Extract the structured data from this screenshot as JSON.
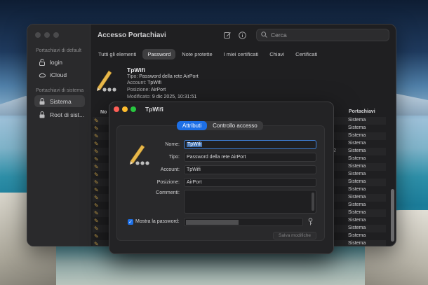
{
  "window": {
    "title": "Accesso Portachiavi",
    "search_placeholder": "Cerca"
  },
  "sidebar": {
    "section_default": "Portachiavi di default",
    "section_system": "Portachiavi di sistema",
    "items": [
      {
        "label": "login",
        "icon": "lock-open-icon"
      },
      {
        "label": "iCloud",
        "icon": "cloud-icon"
      },
      {
        "label": "Sistema",
        "icon": "lock-icon"
      },
      {
        "label": "Root di sist...",
        "icon": "lock-icon"
      }
    ]
  },
  "tabs": [
    "Tutti gli elementi",
    "Password",
    "Note protette",
    "I miei certificati",
    "Chiavi",
    "Certificati"
  ],
  "active_tab": "Password",
  "detail": {
    "name": "TpWifi",
    "tipo_label": "Tipo:",
    "tipo_value": "Password della rete AirPort",
    "account_label": "Account:",
    "account_value": "TpWifi",
    "posizione_label": "Posizione:",
    "posizione_value": "AirPort",
    "modificato_label": "Modificato:",
    "modificato_value": "9 dic 2025, 10:31:51"
  },
  "list": {
    "col_name": "No",
    "col_keychain": "Portachiavi",
    "row_extra": "2",
    "rows": [
      "Sistema",
      "Sistema",
      "Sistema",
      "Sistema",
      "Sistema",
      "Sistema",
      "Sistema",
      "Sistema",
      "Sistema",
      "Sistema",
      "Sistema",
      "Sistema",
      "Sistema",
      "Sistema",
      "Sistema",
      "Sistema",
      "Sistema"
    ]
  },
  "dialog": {
    "title": "TpWifi",
    "segments": [
      "Attributi",
      "Controllo accesso"
    ],
    "active_segment": "Attributi",
    "nome_label": "Nome:",
    "nome_value": "TpWifi",
    "tipo_label": "Tipo:",
    "tipo_value": "Password della rete AirPort",
    "account_label": "Account:",
    "account_value": "TpWifi",
    "posizione_label": "Posizione:",
    "posizione_value": "AirPort",
    "commenti_label": "Commenti:",
    "show_password_label": "Mostra la password:",
    "show_password_checked": true,
    "save_label": "Salva modifiche"
  },
  "colors": {
    "accent": "#1d6fe6",
    "traffic_red": "#ff5f57",
    "traffic_yellow": "#febc2e",
    "traffic_green": "#28c840"
  }
}
